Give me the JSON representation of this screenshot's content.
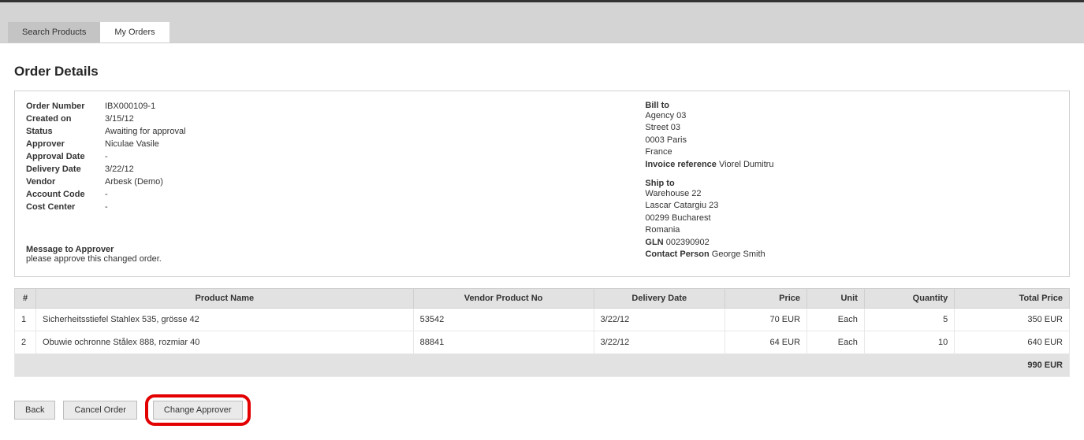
{
  "tabs": {
    "search": "Search Products",
    "orders": "My Orders"
  },
  "page_title": "Order Details",
  "order": {
    "labels": {
      "order_number": "Order Number",
      "created_on": "Created on",
      "status": "Status",
      "approver": "Approver",
      "approval_date": "Approval Date",
      "delivery_date": "Delivery Date",
      "vendor": "Vendor",
      "account_code": "Account Code",
      "cost_center": "Cost Center",
      "message_to_approver": "Message to Approver"
    },
    "values": {
      "order_number": "IBX000109-1",
      "created_on": "3/15/12",
      "status": "Awaiting for approval",
      "approver": "Niculae Vasile",
      "approval_date": "-",
      "delivery_date": "3/22/12",
      "vendor": "Arbesk (Demo)",
      "account_code": "-",
      "cost_center": "-",
      "message_to_approver": "please approve this changed order."
    }
  },
  "bill_to": {
    "label": "Bill to",
    "lines": [
      "Agency 03",
      "Street 03",
      "0003  Paris",
      "France"
    ],
    "invoice_ref_label": "Invoice reference",
    "invoice_ref_value": "Viorel Dumitru"
  },
  "ship_to": {
    "label": "Ship to",
    "lines": [
      "Warehouse 22",
      "Lascar Catargiu 23",
      "00299  Bucharest",
      "Romania"
    ],
    "gln_label": "GLN",
    "gln_value": "002390902",
    "contact_label": "Contact Person",
    "contact_value": "George Smith"
  },
  "table": {
    "headers": {
      "idx": "#",
      "name": "Product Name",
      "vendor_no": "Vendor Product No",
      "delivery": "Delivery Date",
      "price": "Price",
      "unit": "Unit",
      "qty": "Quantity",
      "total": "Total Price"
    },
    "rows": [
      {
        "idx": "1",
        "name": "Sicherheitsstiefel Stahlex 535, grösse 42",
        "vendor_no": "53542",
        "delivery": "3/22/12",
        "price": "70 EUR",
        "unit": "Each",
        "qty": "5",
        "total": "350 EUR"
      },
      {
        "idx": "2",
        "name": "Obuwie ochronne Stålex 888, rozmiar 40",
        "vendor_no": "88841",
        "delivery": "3/22/12",
        "price": "64 EUR",
        "unit": "Each",
        "qty": "10",
        "total": "640 EUR"
      }
    ],
    "grand_total": "990 EUR"
  },
  "buttons": {
    "back": "Back",
    "cancel_order": "Cancel Order",
    "change_approver": "Change Approver"
  }
}
